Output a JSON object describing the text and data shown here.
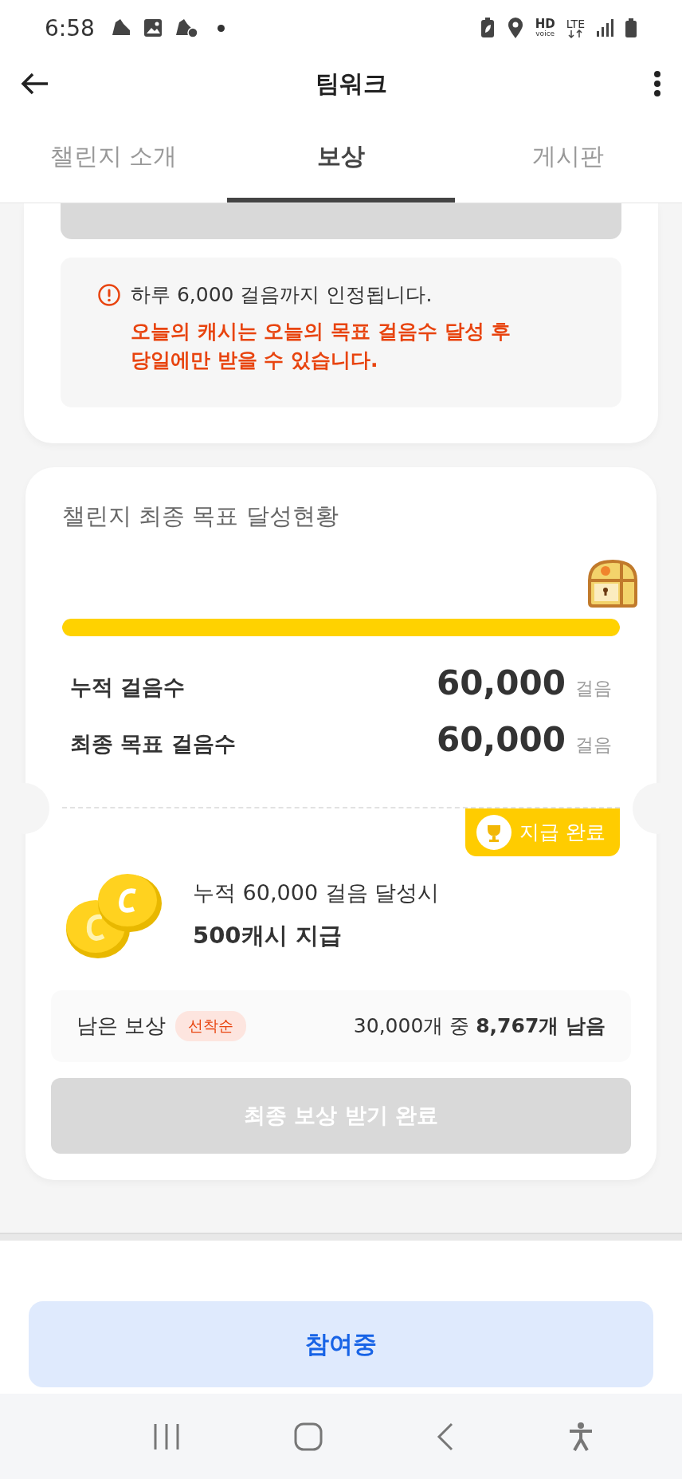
{
  "status_bar": {
    "time": "6:58",
    "hd_label": "HD",
    "voice_label": "voice",
    "network": "LTE"
  },
  "app_bar": {
    "title": "팀워크"
  },
  "tabs": [
    {
      "label": "챌린지 소개",
      "selected": false
    },
    {
      "label": "보상",
      "selected": true
    },
    {
      "label": "게시판",
      "selected": false
    }
  ],
  "notice": {
    "info": "하루 6,000 걸음까지 인정됩니다.",
    "warning_lines": [
      "오늘의 캐시는 오늘의 목표 걸음수 달성 후",
      "당일에만 받을 수 있습니다."
    ]
  },
  "final_goal": {
    "title": "챌린지 최종 목표 달성현황",
    "level": 1,
    "stats": [
      {
        "label": "누적 걸음수",
        "value": "60,000",
        "unit": "걸음"
      },
      {
        "label": "최종 목표 걸음수",
        "value": "60,000",
        "unit": "걸음"
      }
    ],
    "badge": "지급 완료",
    "reward_condition": "누적 60,000 걸음 달성시",
    "reward_amount": "500캐시 지급",
    "remaining": {
      "label": "남은 보상",
      "tag": "선착순",
      "count": "30,000개 중 **8,767개 남음**"
    },
    "claim_button": {
      "label": "최종 보상 받기 완료",
      "disabled": true
    }
  },
  "join_button": {
    "label": "참여중"
  }
}
